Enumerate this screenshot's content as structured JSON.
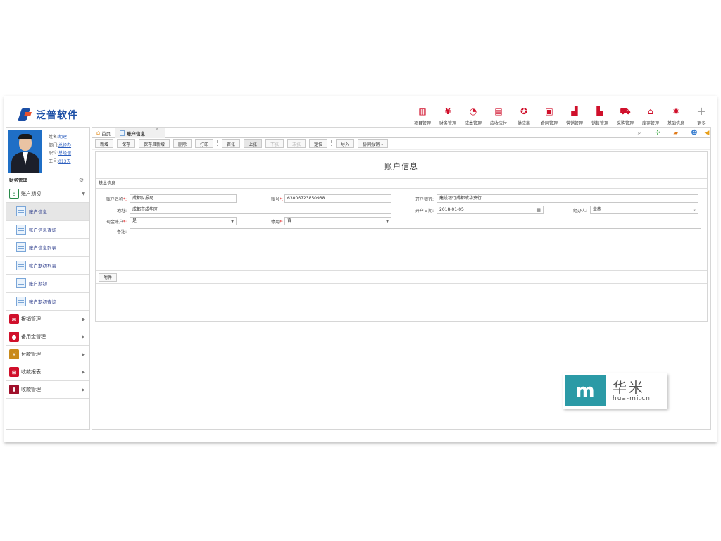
{
  "app": {
    "logo_text": "泛普软件"
  },
  "topnav": [
    {
      "label": "项目管理",
      "icon": "building-icon",
      "glyph": "▥",
      "color": "#d0102b"
    },
    {
      "label": "财务管理",
      "icon": "yen-icon",
      "glyph": "¥",
      "color": "#d0102b"
    },
    {
      "label": "成本管理",
      "icon": "pie-chart-icon",
      "glyph": "◔",
      "color": "#d0102b"
    },
    {
      "label": "应收应付",
      "icon": "document-icon",
      "glyph": "▤",
      "color": "#d0102b"
    },
    {
      "label": "供应商",
      "icon": "medal-icon",
      "glyph": "✪",
      "color": "#d0102b"
    },
    {
      "label": "合同管理",
      "icon": "contract-icon",
      "glyph": "▣",
      "color": "#d0102b"
    },
    {
      "label": "营销管理",
      "icon": "bar-chart-icon",
      "glyph": "▟",
      "color": "#d0102b"
    },
    {
      "label": "销售管理",
      "icon": "column-chart-icon",
      "glyph": "▙",
      "color": "#d0102b"
    },
    {
      "label": "采购管理",
      "icon": "cart-icon",
      "glyph": "⛟",
      "color": "#d0102b"
    },
    {
      "label": "库存管理",
      "icon": "warehouse-icon",
      "glyph": "⌂",
      "color": "#d0102b"
    },
    {
      "label": "基础信息",
      "icon": "gear-icon",
      "glyph": "✹",
      "color": "#d0102b"
    },
    {
      "label": "更多",
      "icon": "plus-icon",
      "glyph": "+",
      "color": "#999999"
    }
  ],
  "profile": {
    "name_label": "姓名:",
    "name": "胡建",
    "dept_label": "部门:",
    "dept": "总经办",
    "pos_label": "职位:",
    "pos": "总经理",
    "id_label": "工号:",
    "id": "013天"
  },
  "sidebar": {
    "section_title": "财务管理",
    "groups": [
      {
        "label": "账户期初",
        "icon": "account-icon",
        "expanded": true
      },
      {
        "label": "报销管理",
        "icon": "receipt-icon"
      },
      {
        "label": "备用金管理",
        "icon": "coins-icon"
      },
      {
        "label": "付款管理",
        "icon": "payment-icon"
      },
      {
        "label": "收款报表",
        "icon": "report-icon"
      },
      {
        "label": "收款管理",
        "icon": "collection-icon"
      }
    ],
    "sub_items": [
      "账户信息",
      "账户信息查询",
      "账户信息列表",
      "账户期初列表",
      "账户期初",
      "账户期初查询"
    ]
  },
  "tabs": {
    "home": "首页",
    "current": "账户信息",
    "close": "×"
  },
  "toolbar": {
    "new": "新增",
    "save": "保存",
    "save_new": "保存且新增",
    "delete": "删除",
    "print": "打印",
    "first": "首张",
    "prev": "上张",
    "next": "下张",
    "last": "末张",
    "locate": "定位",
    "import": "导入",
    "report": "协同报销 ▾"
  },
  "form": {
    "title": "账户信息",
    "section": "基本信息",
    "account_name_label": "账户名称",
    "account_name": "成都财报局",
    "account_no_label": "账号",
    "account_no": "63006723850938",
    "bank_label": "开户银行:",
    "bank": "建设银行成都成华支行",
    "address_label": "地址:",
    "address": "成都市成华区",
    "open_date_label": "开户日期:",
    "open_date": "2018-01-05",
    "handler_label": "经办人:",
    "handler": "章燕",
    "cash_label": "现金账户",
    "cash": "是",
    "disabled_label": "停用",
    "disabled": "否",
    "remark_label": "备注:",
    "attach_button": "附件",
    "req_mark": "*:"
  },
  "watermark": {
    "logo": "m",
    "cn": "华米",
    "en": "hua-mi.cn"
  }
}
